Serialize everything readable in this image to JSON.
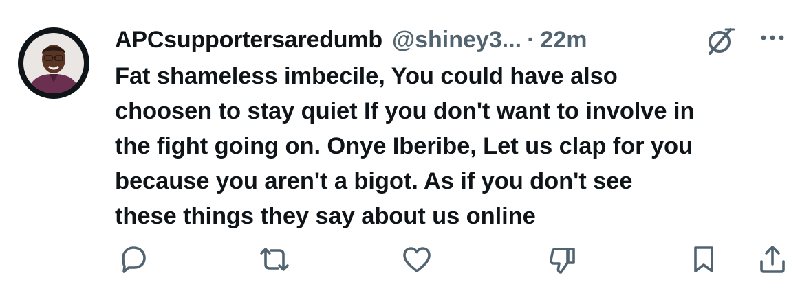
{
  "tweet": {
    "author_name": "APCsupportersaredumb",
    "handle": "@shiney3...",
    "separator": "·",
    "time": "22m",
    "body_lines": [
      "Fat shameless imbecile, You could have also",
      "choosen to stay quiet If you don't want to involve in",
      "the fight going on. Onye Iberibe, Let us clap for you",
      "because you aren't a bigot. As if you don't see",
      "these things they say about us online"
    ]
  },
  "icons": {
    "avatar": "avatar",
    "grok": "grok-icon",
    "more": "more-dots-icon",
    "reply": "reply-bubble-icon",
    "retweet": "retweet-icon",
    "like": "heart-icon",
    "downvote": "thumbs-down-icon",
    "bookmark": "bookmark-icon",
    "share": "share-upload-icon"
  },
  "colors": {
    "text_primary": "#0f1419",
    "text_secondary": "#536471",
    "background": "#ffffff"
  }
}
